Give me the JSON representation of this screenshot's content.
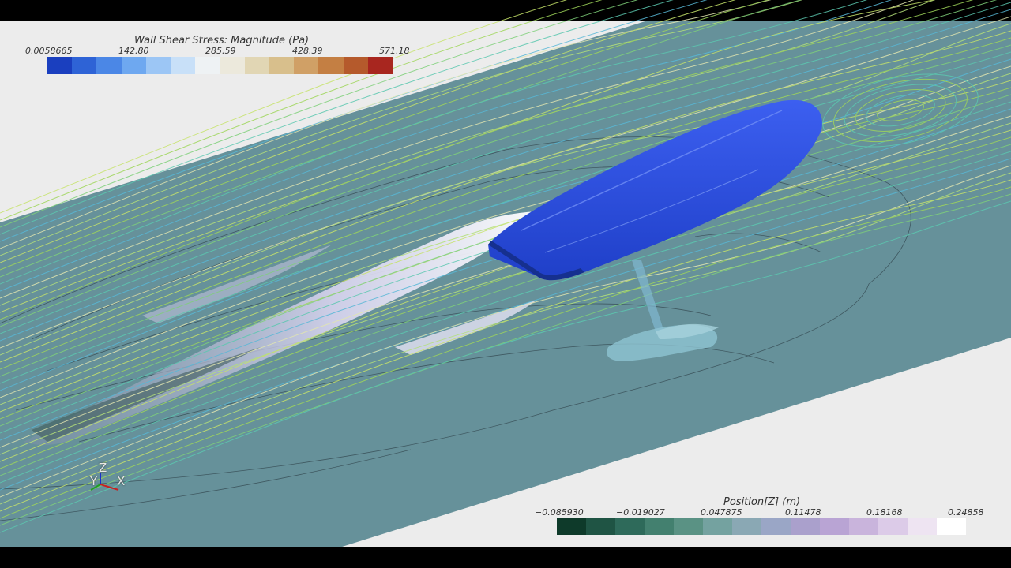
{
  "scene": {
    "background_color": "#ececec",
    "plane_color": "#66919a",
    "hull_color": "#2d4fe0"
  },
  "legend_top": {
    "title": "Wall Shear Stress: Magnitude (Pa)",
    "ticks": [
      "0.0058665",
      "142.80",
      "285.59",
      "428.39",
      "571.18"
    ],
    "colors": [
      "#1a3fbf",
      "#2e63d6",
      "#4b87e6",
      "#6ea8f0",
      "#9cc6f5",
      "#c8e0f8",
      "#eef2f4",
      "#ece9dc",
      "#e1d6b4",
      "#d8bf8c",
      "#d0a066",
      "#c47f43",
      "#b55a2c",
      "#a8261f"
    ]
  },
  "legend_bottom": {
    "title": "Position[Z] (m)",
    "ticks": [
      "−0.085930",
      "−0.019027",
      "0.047875",
      "0.11478",
      "0.18168",
      "0.24858"
    ],
    "colors": [
      "#0e3a2a",
      "#1f5444",
      "#2e6a5a",
      "#43806f",
      "#5a9284",
      "#74a2a0",
      "#8aa8b4",
      "#9aa6c6",
      "#aaa0cc",
      "#b9a4d4",
      "#c9b4dc",
      "#dccbe8",
      "#eee4f2",
      "#ffffff"
    ]
  },
  "axes": {
    "labels": [
      "Z",
      "Y",
      "X"
    ],
    "colors": {
      "z": "#1c2fc8",
      "y": "#20a020",
      "x": "#c82020"
    }
  }
}
